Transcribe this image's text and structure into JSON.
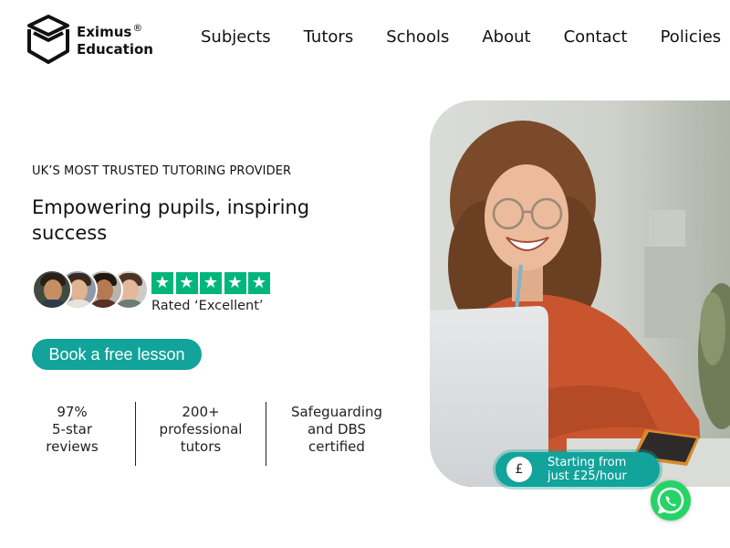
{
  "brand": {
    "name_line1": "Eximus",
    "name_line2": "Education",
    "registered": "®",
    "icon": "open-box-logo-icon"
  },
  "nav": {
    "items": [
      "Subjects",
      "Tutors",
      "Schools",
      "About",
      "Contact",
      "Policies"
    ]
  },
  "hero": {
    "eyebrow": "UK’S MOST TRUSTED TUTORING PROVIDER",
    "headline": "Empowering pupils, inspiring success",
    "rating_stars": 5,
    "rating_label": "Rated ‘Excellent’",
    "cta_label": "Book a free lesson",
    "stats": [
      {
        "line1": "97%",
        "line2": "5-star",
        "line3": "reviews"
      },
      {
        "line1": "200+",
        "line2": "professional",
        "line3": "tutors"
      },
      {
        "line1": "Safeguarding",
        "line2": "and DBS",
        "line3": "certified"
      }
    ]
  },
  "price_badge": {
    "icon_symbol": "£",
    "line1": "Starting from",
    "line2": "just £25/hour"
  },
  "colors": {
    "accent": "#12a39b",
    "trustpilot_green": "#00b67a",
    "whatsapp_green": "#25d366"
  },
  "icons": {
    "whatsapp": "whatsapp-icon",
    "star": "star-icon",
    "pound": "pound-icon"
  }
}
